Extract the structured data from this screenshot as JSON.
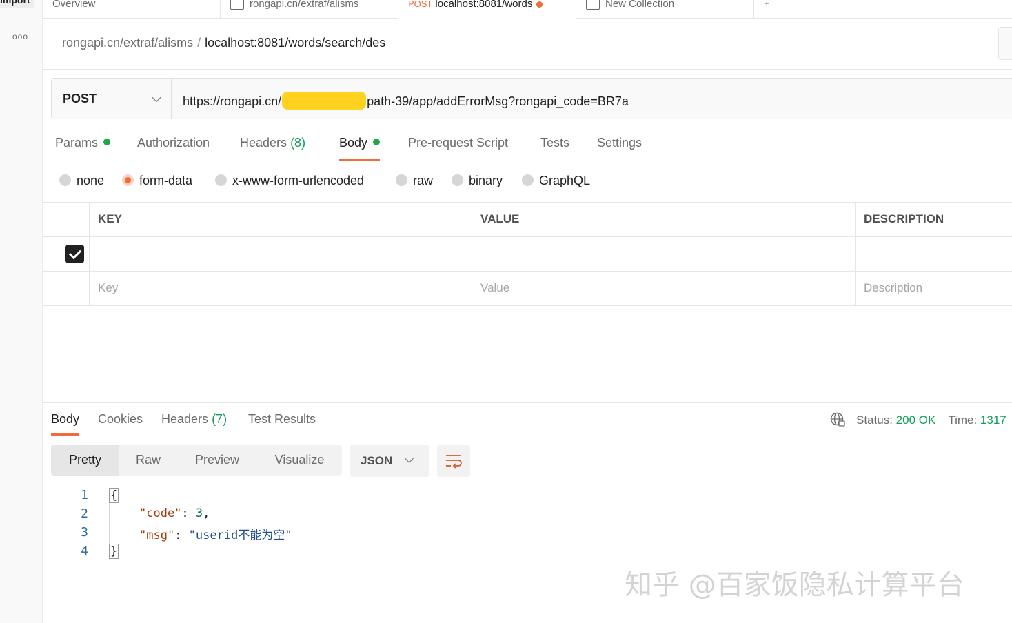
{
  "left_rail": {
    "import_label": "Import",
    "more_icon": "ellipsis-icon"
  },
  "tabs": [
    {
      "label": "Overview"
    },
    {
      "label": "rongapi.cn/extraf/alisms"
    },
    {
      "method": "POST",
      "label": "localhost:8081/words"
    },
    {
      "label": "New Collection"
    }
  ],
  "breadcrumb": {
    "parent": "rongapi.cn/extraf/alisms",
    "separator": "/",
    "current": "localhost:8081/words/search/des"
  },
  "request": {
    "method": "POST",
    "url_prefix": "https://rongapi.cn/",
    "url_suffix": "path-39/app/addErrorMsg?rongapi_code=BR7a"
  },
  "request_tabs": [
    {
      "label": "Params"
    },
    {
      "label": "Authorization"
    },
    {
      "label": "Headers",
      "count": "(8)"
    },
    {
      "label": "Body"
    },
    {
      "label": "Pre-request Script"
    },
    {
      "label": "Tests"
    },
    {
      "label": "Settings"
    }
  ],
  "body_types": [
    "none",
    "form-data",
    "x-www-form-urlencoded",
    "raw",
    "binary",
    "GraphQL"
  ],
  "body_type_selected": "form-data",
  "table": {
    "headers": [
      "KEY",
      "VALUE",
      "DESCRIPTION"
    ],
    "placeholders": {
      "key": "Key",
      "value": "Value",
      "description": "Description"
    }
  },
  "response_tabs": [
    {
      "label": "Body"
    },
    {
      "label": "Cookies"
    },
    {
      "label": "Headers",
      "count": "(7)"
    },
    {
      "label": "Test Results"
    }
  ],
  "status": {
    "label": "Status:",
    "value": "200 OK",
    "time_label": "Time:",
    "time_value": "1317"
  },
  "view_modes": [
    "Pretty",
    "Raw",
    "Preview",
    "Visualize"
  ],
  "format": "JSON",
  "code": {
    "line_numbers": [
      "1",
      "2",
      "3",
      "4"
    ],
    "open": "{",
    "close": "}",
    "key1": "\"code\"",
    "val1": "3",
    "key2": "\"msg\"",
    "val2": "\"userid不能为空\""
  },
  "watermark": "知乎 @百家饭隐私计算平台",
  "colors": {
    "accent": "#f26b3a",
    "ok": "#0f9d58",
    "redaction": "#ffd21f"
  }
}
